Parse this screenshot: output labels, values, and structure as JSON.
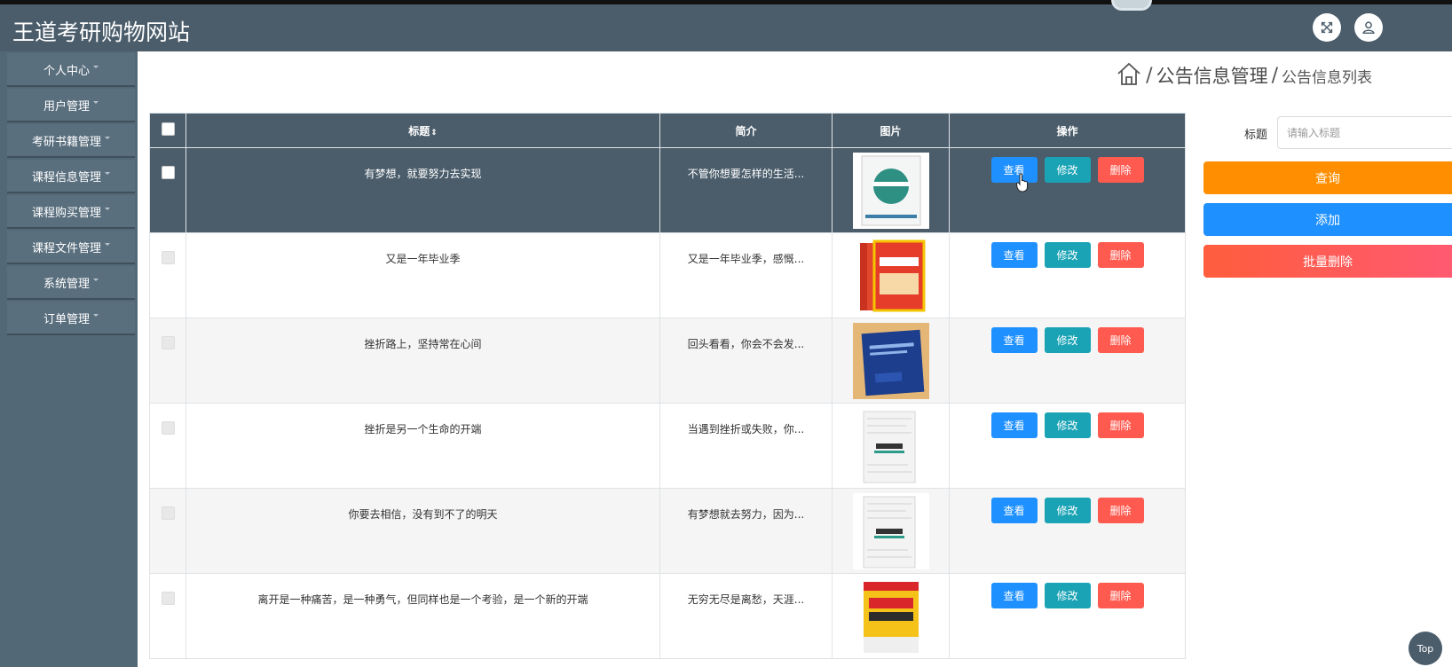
{
  "header": {
    "title": "王道考研购物网站",
    "fullscreen_icon": "expand-icon",
    "user_icon": "user-icon"
  },
  "sidebar": {
    "items": [
      {
        "label": "个人中心"
      },
      {
        "label": "用户管理"
      },
      {
        "label": "考研书籍管理"
      },
      {
        "label": "课程信息管理"
      },
      {
        "label": "课程购买管理"
      },
      {
        "label": "课程文件管理"
      },
      {
        "label": "系统管理"
      },
      {
        "label": "订单管理"
      }
    ]
  },
  "breadcrumb": {
    "home_icon": "home-icon",
    "sep": "/",
    "section": "公告信息管理",
    "page": "公告信息列表"
  },
  "table": {
    "headers": {
      "title": "标题",
      "sort_icon": "⇕",
      "intro": "简介",
      "image": "图片",
      "actions": "操作"
    },
    "rows": [
      {
        "title": "有梦想，就要努力去实现",
        "intro": "不管你想要怎样的生活...",
        "image": "book-cover-green-icon"
      },
      {
        "title": "又是一年毕业季",
        "intro": "又是一年毕业季，感慨...",
        "image": "book-set-red-icon"
      },
      {
        "title": "挫折路上，坚持常在心间",
        "intro": "回头看看，你会不会发...",
        "image": "book-cover-blue-icon"
      },
      {
        "title": "挫折是另一个生命的开端",
        "intro": "当遇到挫折或失败，你...",
        "image": "book-cover-white-icon"
      },
      {
        "title": "你要去相信，没有到不了的明天",
        "intro": "有梦想就去努力，因为...",
        "image": "book-cover-white-icon"
      },
      {
        "title": "离开是一种痛苦，是一种勇气，但同样也是一个考验，是一个新的开端",
        "intro": "无穷无尽是离愁，天涯...",
        "image": "book-cover-yellow-icon"
      }
    ],
    "actions": {
      "view": "查看",
      "edit": "修改",
      "delete": "删除"
    }
  },
  "search": {
    "label": "标题",
    "placeholder": "请输入标题",
    "query": "查询",
    "add": "添加",
    "bulk_delete": "批量删除"
  },
  "footer": {
    "top_label": "Top"
  },
  "colors": {
    "header": "#4b5d6b",
    "sidebar": "#536877",
    "view": "#1e90ff",
    "edit": "#1aa3b5",
    "delete": "#ff5a4f",
    "query": "#ff8f00"
  }
}
